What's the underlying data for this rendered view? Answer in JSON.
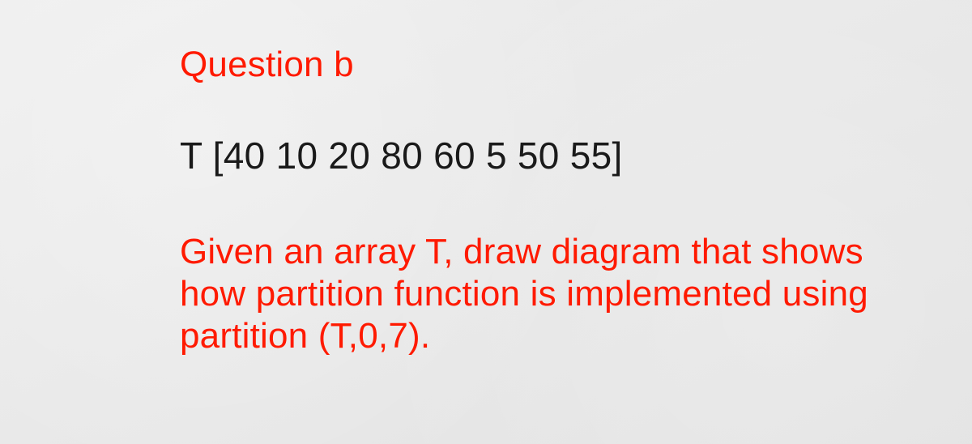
{
  "heading": "Question b",
  "array_text": "T [40 10 20 80 60 5 50 55]",
  "prompt": "Given an array T, draw diagram that shows how partition function is implemented using partition (T,0,7)."
}
